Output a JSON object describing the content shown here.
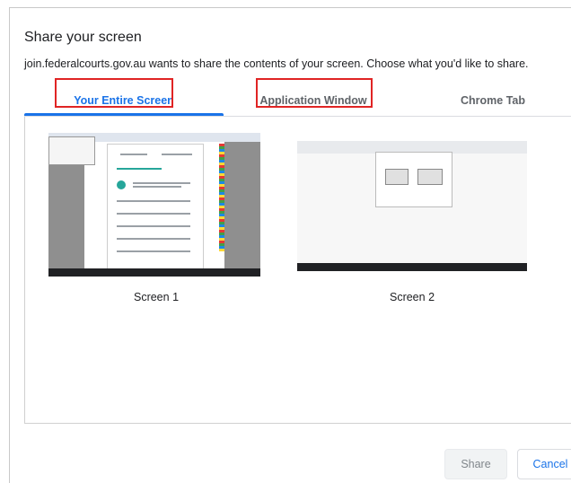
{
  "dialog": {
    "title": "Share your screen",
    "subtitle": "join.federalcourts.gov.au wants to share the contents of your screen. Choose what you'd like to share."
  },
  "tabs": [
    {
      "label": "Your Entire Screen",
      "active": true
    },
    {
      "label": "Application Window",
      "active": false
    },
    {
      "label": "Chrome Tab",
      "active": false
    }
  ],
  "screens": [
    {
      "label": "Screen 1"
    },
    {
      "label": "Screen 2"
    }
  ],
  "buttons": {
    "share": "Share",
    "cancel": "Cancel"
  },
  "colors": {
    "accent": "#1a73e8",
    "highlight": "#e02424"
  }
}
